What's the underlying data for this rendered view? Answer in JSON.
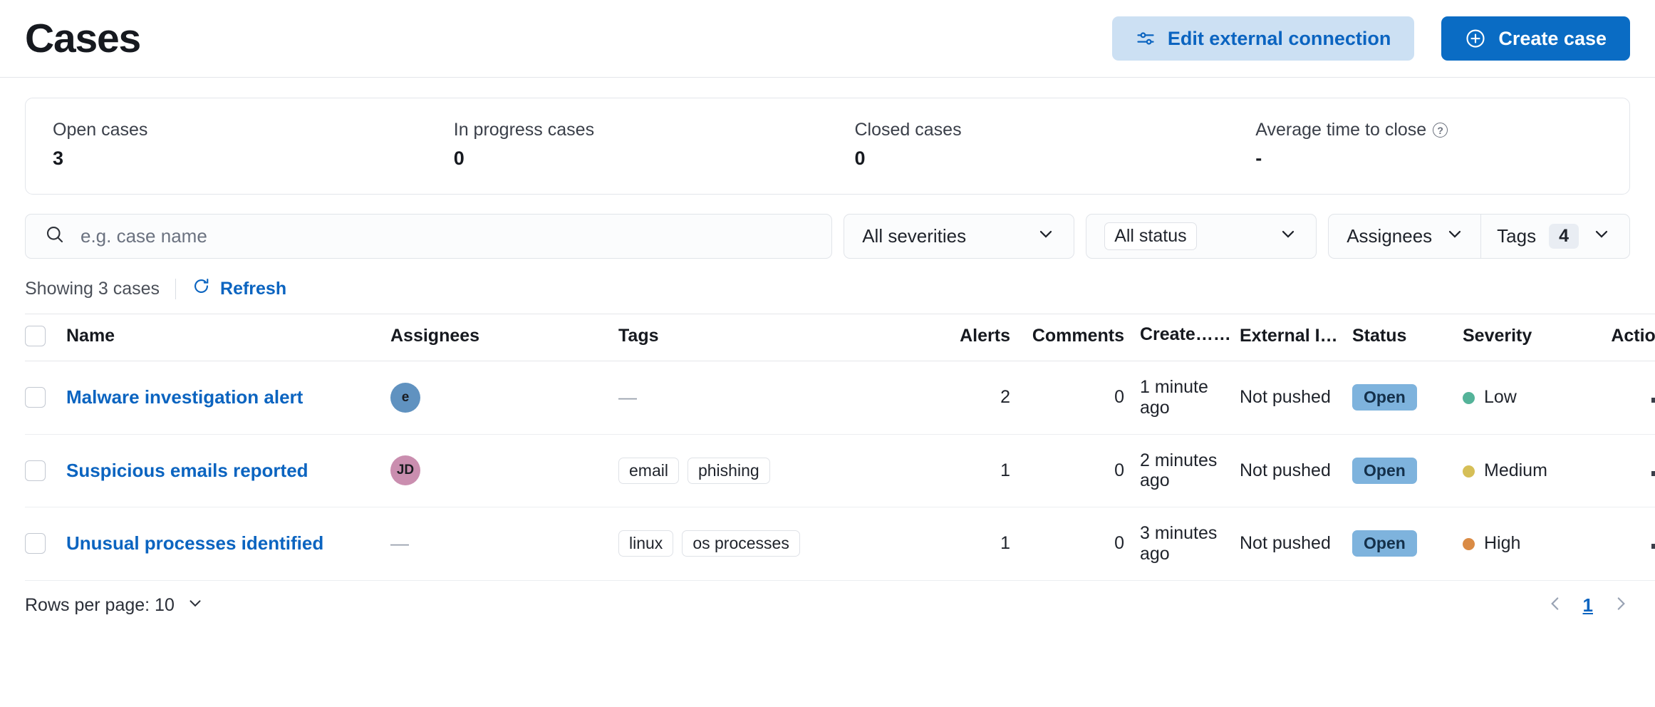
{
  "header": {
    "title": "Cases",
    "edit_connection_label": "Edit external connection",
    "create_case_label": "Create case"
  },
  "stats": [
    {
      "label": "Open cases",
      "value": "3",
      "has_help": false
    },
    {
      "label": "In progress cases",
      "value": "0",
      "has_help": false
    },
    {
      "label": "Closed cases",
      "value": "0",
      "has_help": false
    },
    {
      "label": "Average time to close",
      "value": "-",
      "has_help": true,
      "help_glyph": "?"
    }
  ],
  "filters": {
    "search_placeholder": "e.g. case name",
    "search_value": "",
    "severity_label": "All severities",
    "status_label": "All status",
    "assignees_label": "Assignees",
    "tags_label": "Tags",
    "tags_count": "4"
  },
  "toolbar": {
    "showing_text": "Showing 3 cases",
    "refresh_label": "Refresh"
  },
  "table": {
    "columns": [
      "Name",
      "Assignees",
      "Tags",
      "Alerts",
      "Comments",
      "Create…",
      "External In…",
      "Status",
      "Severity",
      "Actions"
    ],
    "sorted_column": "Create…",
    "sort_direction": "desc",
    "rows": [
      {
        "name": "Malware investigation alert",
        "assignee_initials": "e",
        "assignee_color": "#6092c0",
        "assignee_empty": false,
        "tags": [],
        "tags_empty_dash": "—",
        "alerts": "2",
        "comments": "0",
        "created": "1 minute ago",
        "external": "Not pushed",
        "status": "Open",
        "severity": "Low",
        "severity_color": "#54b399"
      },
      {
        "name": "Suspicious emails reported",
        "assignee_initials": "JD",
        "assignee_color": "#ca8eaf",
        "assignee_empty": false,
        "tags": [
          "email",
          "phishing"
        ],
        "tags_empty_dash": "",
        "alerts": "1",
        "comments": "0",
        "created": "2 minutes ago",
        "external": "Not pushed",
        "status": "Open",
        "severity": "Medium",
        "severity_color": "#d6bf57"
      },
      {
        "name": "Unusual processes identified",
        "assignee_initials": "",
        "assignee_color": "",
        "assignee_empty": true,
        "assignee_dash": "—",
        "tags": [
          "linux",
          "os processes"
        ],
        "tags_empty_dash": "",
        "alerts": "1",
        "comments": "0",
        "created": "3 minutes ago",
        "external": "Not pushed",
        "status": "Open",
        "severity": "High",
        "severity_color": "#da8b45"
      }
    ]
  },
  "footer": {
    "rows_per_page_label": "Rows per page: 10",
    "current_page": "1"
  },
  "colors": {
    "accent_blue": "#0a6cc4",
    "link_blue": "#0b64c0",
    "secondary_btn_bg": "#cce0f3",
    "status_badge_bg": "#7eb3dd"
  }
}
